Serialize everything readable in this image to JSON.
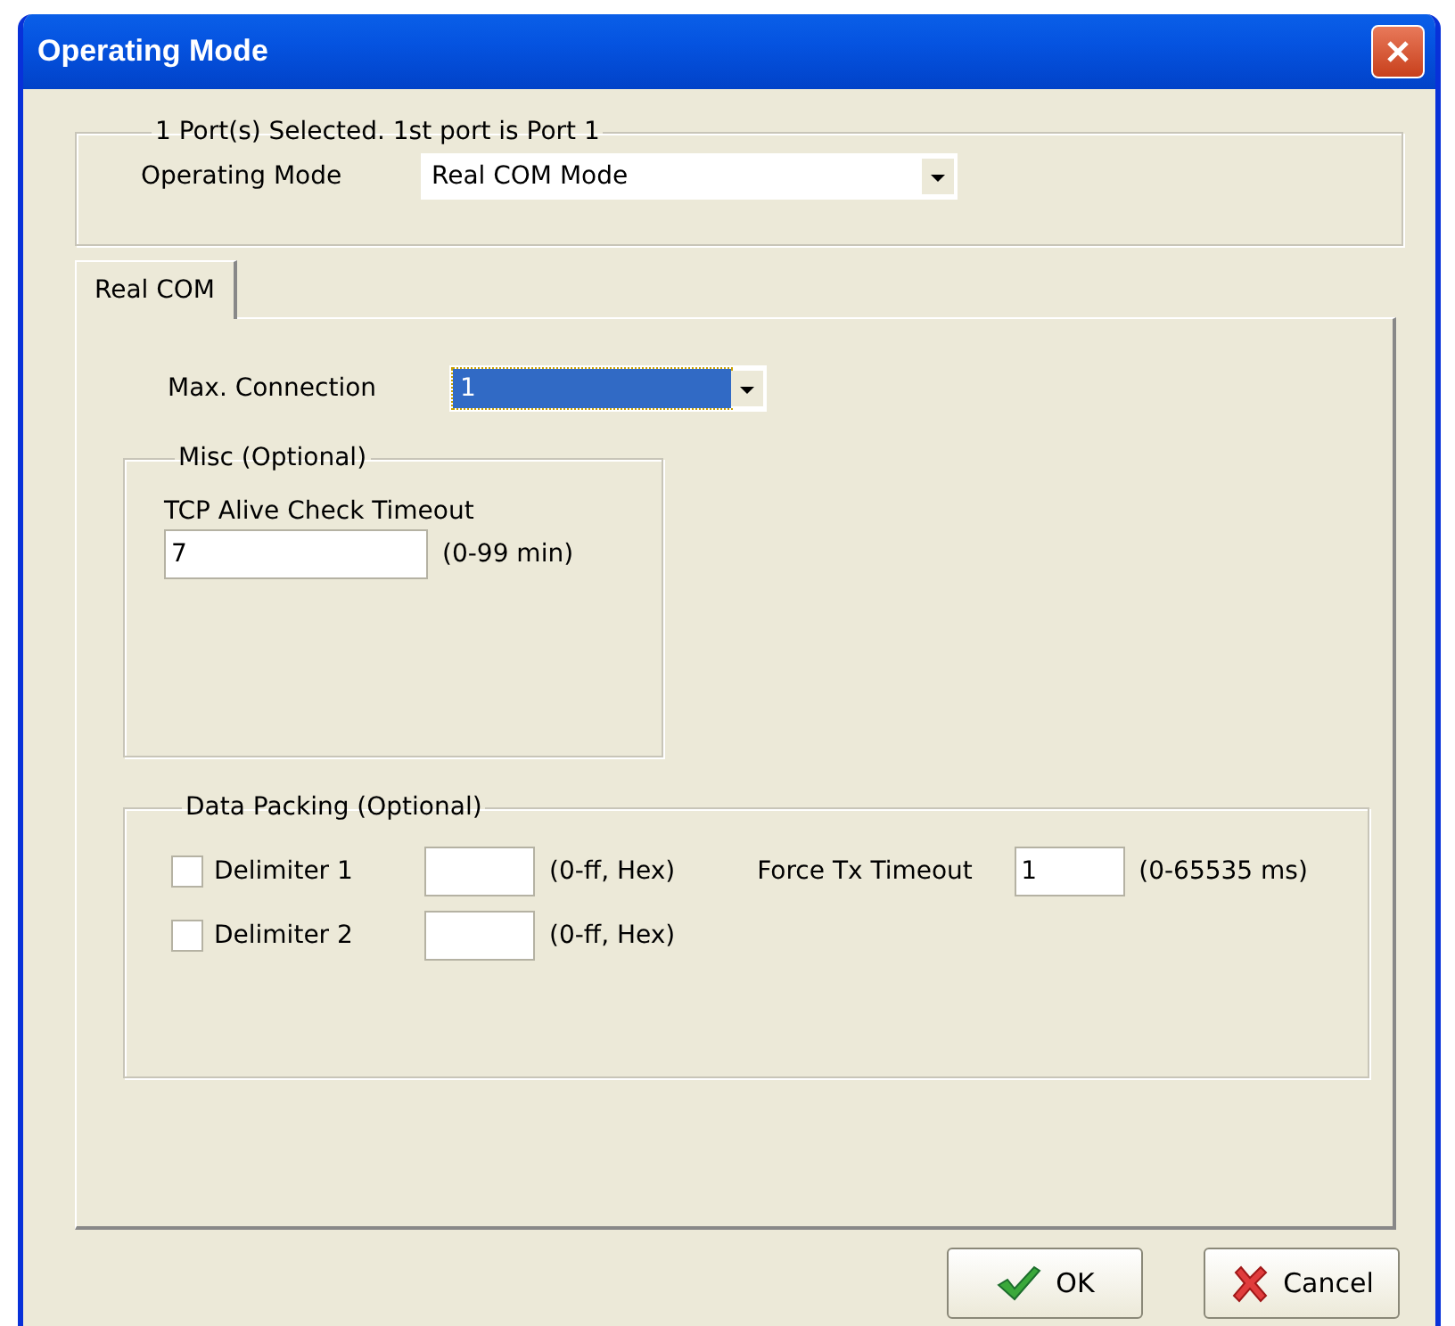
{
  "window": {
    "title": "Operating Mode"
  },
  "port_group": {
    "legend": "1 Port(s) Selected. 1st port is Port 1",
    "operating_mode": {
      "label": "Operating Mode",
      "value": "Real COM Mode"
    }
  },
  "tabs": [
    {
      "label": "Real COM",
      "selected": true
    }
  ],
  "max_connection": {
    "label": "Max. Connection",
    "value": "1",
    "focused": true
  },
  "misc": {
    "legend": "Misc (Optional)",
    "tcp_alive": {
      "label": "TCP Alive Check Timeout",
      "value": "7",
      "hint": "(0-99 min)"
    }
  },
  "data_packing": {
    "legend": "Data Packing (Optional)",
    "delimiters": [
      {
        "label": "Delimiter 1",
        "checked": false,
        "hint": "(0-ff, Hex)"
      },
      {
        "label": "Delimiter 2",
        "checked": false,
        "hint": "(0-ff, Hex)"
      }
    ],
    "force_tx": {
      "label": "Force Tx Timeout",
      "value": "1",
      "hint": "(0-65535 ms)"
    }
  },
  "buttons": [
    {
      "kind": "ok",
      "label": "OK"
    },
    {
      "kind": "cancel",
      "label": "Cancel"
    }
  ]
}
